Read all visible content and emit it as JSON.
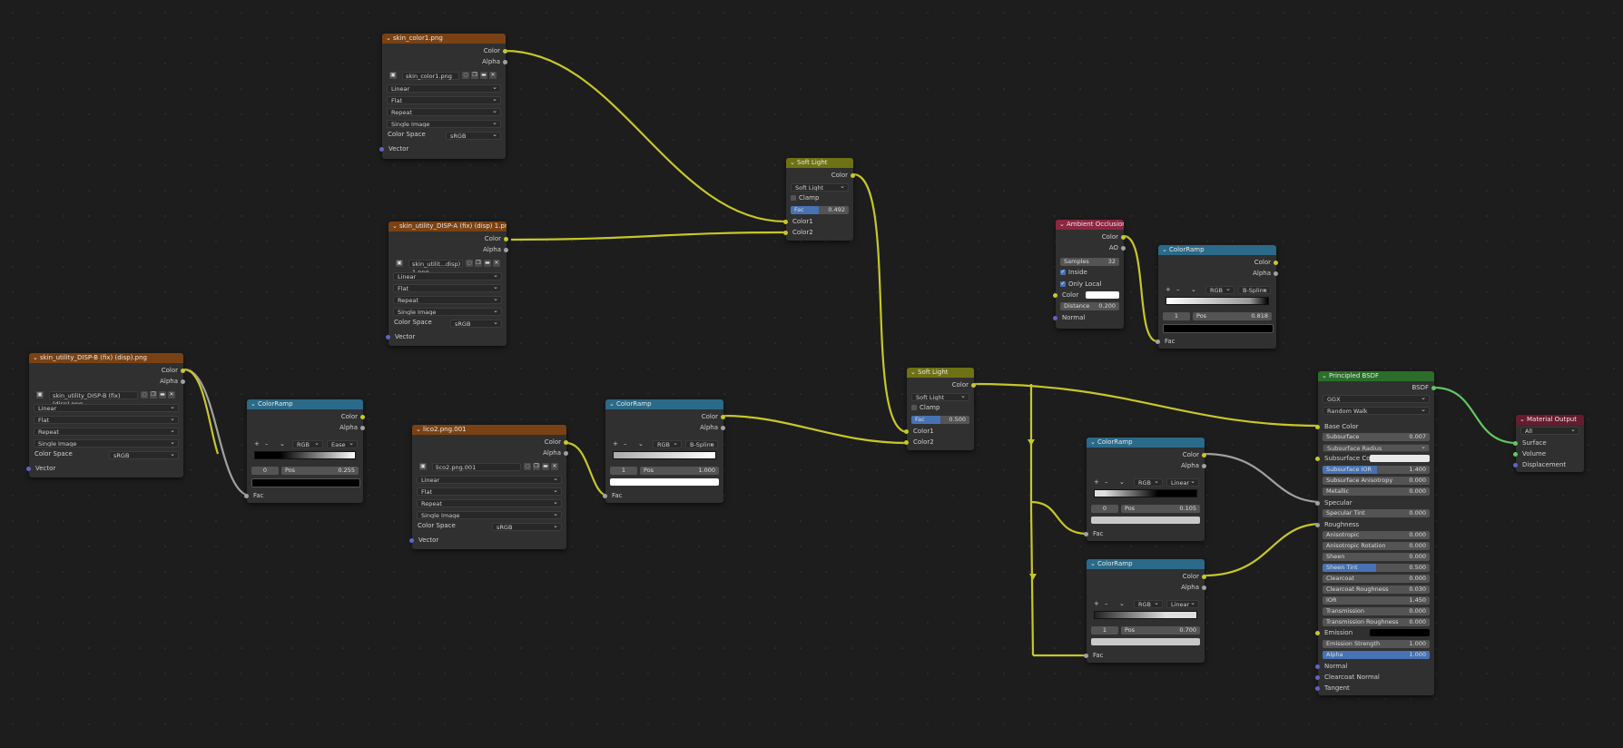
{
  "nodes": {
    "tex1": {
      "title": "skin_color1.png",
      "outputs": [
        "Color",
        "Alpha"
      ],
      "image": "skin_color1.png",
      "interpolation": "Linear",
      "projection": "Flat",
      "extension": "Repeat",
      "source": "Single Image",
      "colorspace_label": "Color Space",
      "colorspace": "sRGB",
      "input": "Vector"
    },
    "tex2": {
      "title": "skin_utility_DISP-A (fix) (disp) 1.png",
      "outputs": [
        "Color",
        "Alpha"
      ],
      "image": "skin_utilit...disp) 1.png",
      "interpolation": "Linear",
      "projection": "Flat",
      "extension": "Repeat",
      "source": "Single Image",
      "colorspace_label": "Color Space",
      "colorspace": "sRGB",
      "input": "Vector"
    },
    "tex3": {
      "title": "skin_utility_DISP-B (fix) (disp).png",
      "outputs": [
        "Color",
        "Alpha"
      ],
      "image": "skin_utility_DISP-B (fix) (disp).png",
      "interpolation": "Linear",
      "projection": "Flat",
      "extension": "Repeat",
      "source": "Single Image",
      "colorspace_label": "Color Space",
      "colorspace": "sRGB",
      "input": "Vector"
    },
    "tex4": {
      "title": "lico2.png.001",
      "outputs": [
        "Color",
        "Alpha"
      ],
      "image": "lico2.png.001",
      "interpolation": "Linear",
      "projection": "Flat",
      "extension": "Repeat",
      "source": "Single Image",
      "colorspace_label": "Color Space",
      "colorspace": "sRGB",
      "input": "Vector"
    },
    "ramp1": {
      "title": "ColorRamp",
      "outputs": [
        "Color",
        "Alpha"
      ],
      "mode": "RGB",
      "interp": "Ease",
      "index": "0",
      "pos_label": "Pos",
      "pos": "0.255",
      "input": "Fac"
    },
    "ramp2": {
      "title": "ColorRamp",
      "outputs": [
        "Color",
        "Alpha"
      ],
      "mode": "RGB",
      "interp": "B-Spline",
      "index": "1",
      "pos_label": "Pos",
      "pos": "1.000",
      "input": "Fac"
    },
    "ramp3": {
      "title": "ColorRamp",
      "outputs": [
        "Color",
        "Alpha"
      ],
      "mode": "RGB",
      "interp": "B-Spline",
      "index": "1",
      "pos_label": "Pos",
      "pos": "0.818",
      "input": "Fac"
    },
    "ramp4": {
      "title": "ColorRamp",
      "outputs": [
        "Color",
        "Alpha"
      ],
      "mode": "RGB",
      "interp": "Linear",
      "index": "0",
      "pos_label": "Pos",
      "pos": "0.105",
      "input": "Fac"
    },
    "ramp5": {
      "title": "ColorRamp",
      "outputs": [
        "Color",
        "Alpha"
      ],
      "mode": "RGB",
      "interp": "Linear",
      "index": "1",
      "pos_label": "Pos",
      "pos": "0.700",
      "input": "Fac"
    },
    "mix1": {
      "title": "Soft Light",
      "output": "Color",
      "blend": "Soft Light",
      "clamp": "Clamp",
      "fac_label": "Fac",
      "fac": "0.492",
      "fac_fraction": 0.492,
      "inputs": [
        "Color1",
        "Color2"
      ]
    },
    "mix2": {
      "title": "Soft Light",
      "output": "Color",
      "blend": "Soft Light",
      "clamp": "Clamp",
      "fac_label": "Fac",
      "fac": "0.500",
      "fac_fraction": 0.5,
      "inputs": [
        "Color1",
        "Color2"
      ]
    },
    "ao": {
      "title": "Ambient Occlusion",
      "outputs": [
        "Color",
        "AO"
      ],
      "samples_label": "Samples",
      "samples": "32",
      "inside": "Inside",
      "only_local": "Only Local",
      "color_label": "Color",
      "distance_label": "Distance",
      "distance": "0.200",
      "normal": "Normal"
    },
    "bsdf": {
      "title": "Principled BSDF",
      "output": "BSDF",
      "distribution": "GGX",
      "subsurface_method": "Random Walk",
      "base_color": "Base Color",
      "subsurface": "Subsurface",
      "subsurface_val": "0.007",
      "subsurface_radius": "Subsurface Radius",
      "subsurface_color": "Subsurface Color",
      "subsurface_ior": "Subsurface IOR",
      "subsurface_ior_val": "1.400",
      "subsurface_aniso": "Subsurface Anisotropy",
      "subsurface_aniso_val": "0.000",
      "metallic": "Metallic",
      "metallic_val": "0.000",
      "specular": "Specular",
      "specular_tint": "Specular Tint",
      "specular_tint_val": "0.000",
      "roughness": "Roughness",
      "anisotropic": "Anisotropic",
      "anisotropic_val": "0.000",
      "aniso_rot": "Anisotropic Rotation",
      "aniso_rot_val": "0.000",
      "sheen": "Sheen",
      "sheen_val": "0.000",
      "sheen_tint": "Sheen Tint",
      "sheen_tint_val": "0.500",
      "sheen_tint_fraction": 0.5,
      "clearcoat": "Clearcoat",
      "clearcoat_val": "0.000",
      "clearcoat_rough": "Clearcoat Roughness",
      "clearcoat_rough_val": "0.030",
      "ior": "IOR",
      "ior_val": "1.450",
      "transmission": "Transmission",
      "transmission_val": "0.000",
      "trans_rough": "Transmission Roughness",
      "trans_rough_val": "0.000",
      "emission": "Emission",
      "emission_strength": "Emission Strength",
      "emission_strength_val": "1.000",
      "alpha": "Alpha",
      "alpha_val": "1.000",
      "normal": "Normal",
      "clearcoat_normal": "Clearcoat Normal",
      "tangent": "Tangent"
    },
    "out": {
      "title": "Material Output",
      "target": "All",
      "inputs": [
        "Surface",
        "Volume",
        "Displacement"
      ]
    }
  },
  "icons": {
    "add": "+",
    "remove": "–",
    "menu": "⌄",
    "close": "✕"
  },
  "colors": {
    "wire_color": "#c7c729",
    "wire_shader": "#63c763",
    "wire_gray": "#a1a1a1"
  }
}
